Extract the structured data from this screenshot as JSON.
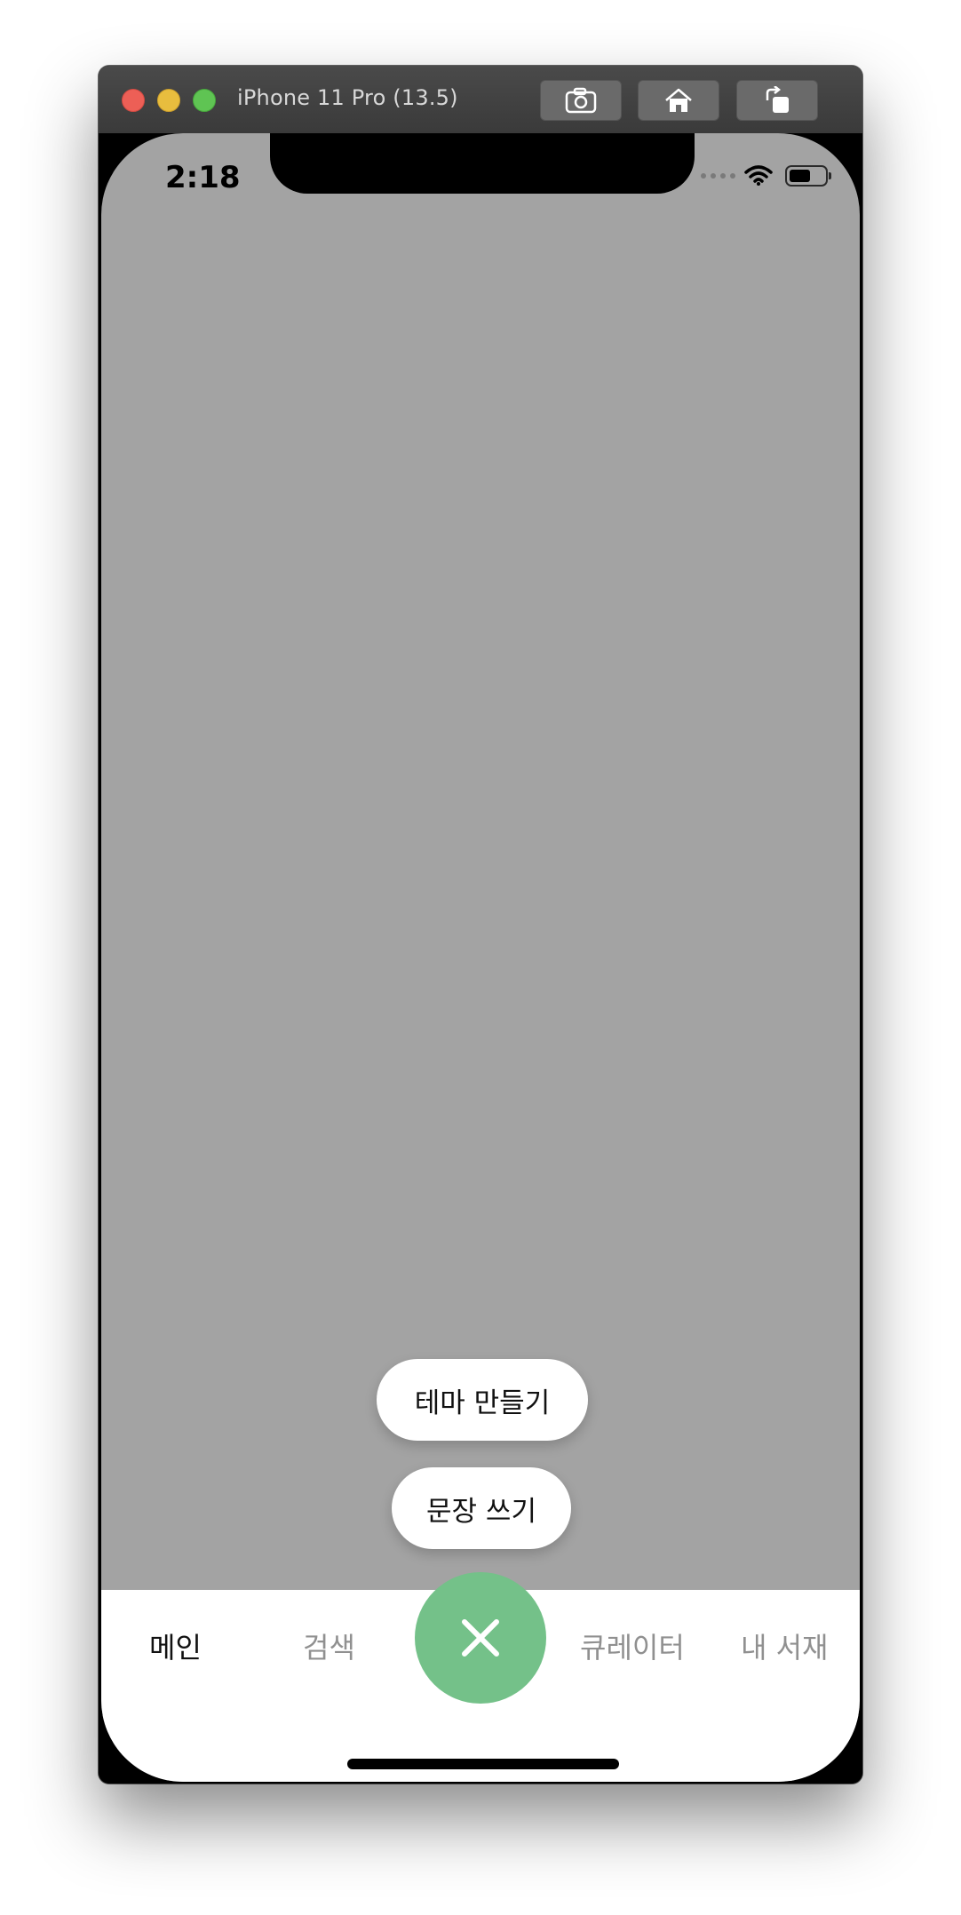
{
  "window": {
    "title": "iPhone 11 Pro (13.5)",
    "toolbar": {
      "screenshot_icon": "camera-icon",
      "home_icon": "home-icon",
      "rotate_icon": "rotate-icon"
    }
  },
  "status_bar": {
    "time": "2:18",
    "battery_level": 0.6
  },
  "menu": {
    "create_theme_label": "테마 만들기",
    "write_sentence_label": "문장 쓰기"
  },
  "tab_bar": {
    "tabs": [
      {
        "label": "메인",
        "active": true
      },
      {
        "label": "검색",
        "active": false
      },
      {
        "label": "큐레이터",
        "active": false
      },
      {
        "label": "내 서재",
        "active": false
      }
    ],
    "fab_icon": "close-icon"
  },
  "colors": {
    "overlay": "#a3a3a3",
    "fab": "#74c189",
    "active_tab": "#111111",
    "inactive_tab": "#909090"
  }
}
